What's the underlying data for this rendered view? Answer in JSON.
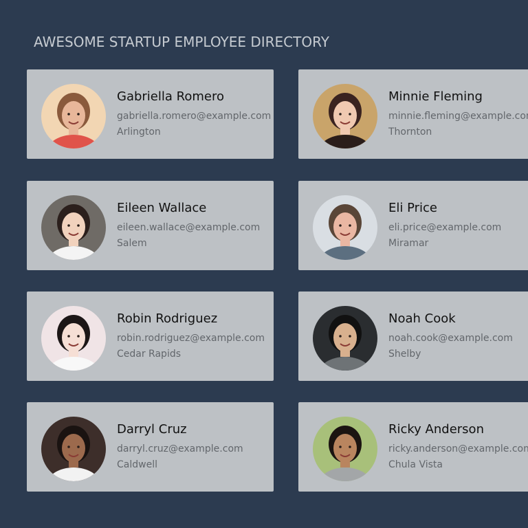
{
  "header": {
    "title": "AWESOME STARTUP EMPLOYEE DIRECTORY"
  },
  "employees": [
    {
      "name": "Gabriella Romero",
      "email": "gabriella.romero@example.com",
      "city": "Arlington",
      "avatar_icon": "person-photo-icon",
      "bg": "#f2d6b3",
      "skin": "#e8b79a",
      "hair": "#8a5a3c",
      "shirt": "#e0534a"
    },
    {
      "name": "Minnie Fleming",
      "email": "minnie.fleming@example.com",
      "city": "Thornton",
      "avatar_icon": "person-photo-icon",
      "bg": "#c9a46a",
      "skin": "#f0c9b1",
      "hair": "#3a2320",
      "shirt": "#2a1d1a"
    },
    {
      "name": "Eileen Wallace",
      "email": "eileen.wallace@example.com",
      "city": "Salem",
      "avatar_icon": "person-photo-icon",
      "bg": "#6f6b66",
      "skin": "#f1d2bd",
      "hair": "#2b1f1c",
      "shirt": "#f4f4f4"
    },
    {
      "name": "Eli Price",
      "email": "eli.price@example.com",
      "city": "Miramar",
      "avatar_icon": "person-photo-icon",
      "bg": "#d9dee3",
      "skin": "#eab7a3",
      "hair": "#5a4638",
      "shirt": "#5c6f80"
    },
    {
      "name": "Robin Rodriguez",
      "email": "robin.rodriguez@example.com",
      "city": "Cedar Rapids",
      "avatar_icon": "person-photo-icon",
      "bg": "#f0e4e6",
      "skin": "#f6dfd5",
      "hair": "#1c1616",
      "shirt": "#f8f8f8"
    },
    {
      "name": "Noah Cook",
      "email": "noah.cook@example.com",
      "city": "Shelby",
      "avatar_icon": "person-photo-icon",
      "bg": "#2a2d30",
      "skin": "#d8b08e",
      "hair": "#111111",
      "shirt": "#6e7376"
    },
    {
      "name": "Darryl Cruz",
      "email": "darryl.cruz@example.com",
      "city": "Caldwell",
      "avatar_icon": "person-photo-icon",
      "bg": "#3d2e2a",
      "skin": "#9c6a4d",
      "hair": "#1a1311",
      "shirt": "#f2f2f2"
    },
    {
      "name": "Ricky Anderson",
      "email": "ricky.anderson@example.com",
      "city": "Chula Vista",
      "avatar_icon": "person-photo-icon",
      "bg": "#a8c07a",
      "skin": "#b9855f",
      "hair": "#1b1411",
      "shirt": "#a3a6a8"
    }
  ]
}
